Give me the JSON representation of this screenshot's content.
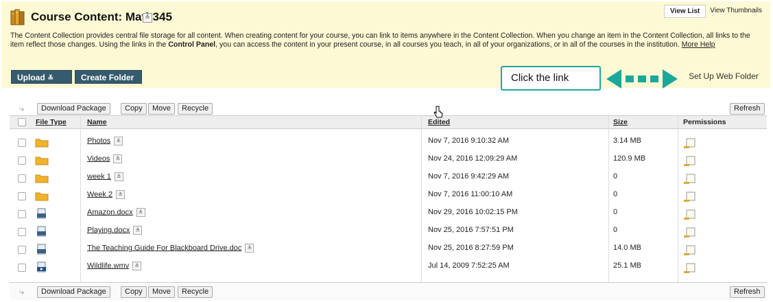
{
  "header": {
    "title": "Course Content: Math345",
    "view_list": "View List",
    "view_thumbnails": "View Thumbnails",
    "description_part1": "The Content Collection provides central file storage for all content. When creating content for your course, you can link to items anywhere in the Content Collection. When you change an item in the Content Collection, all links to the item reflect those changes. Using the links in the ",
    "description_bold": "Control Panel",
    "description_part2": ", you can access the content in your present course, in all courses you teach, in all of your organizations, or in all of the courses in the institution. ",
    "more_help": "More Help"
  },
  "toolbar": {
    "upload_label": "Upload",
    "create_folder_label": "Create Folder",
    "set_up_web_folder": "Set Up Web Folder"
  },
  "callout": {
    "text": "Click the link",
    "color": "#1aa89a"
  },
  "actions": {
    "download_package": "Download Package",
    "copy": "Copy",
    "move": "Move",
    "recycle": "Recycle",
    "refresh": "Refresh"
  },
  "columns": {
    "file_type": "File Type",
    "name": "Name",
    "edited": "Edited",
    "size": "Size",
    "permissions": "Permissions"
  },
  "rows": [
    {
      "type": "folder",
      "name": "Photos",
      "edited": "Nov 7, 2016 9:10:32 AM",
      "size": "3.14 MB"
    },
    {
      "type": "folder",
      "name": "Videos",
      "edited": "Nov 24, 2016 12:09:29 AM",
      "size": "120.9 MB"
    },
    {
      "type": "folder",
      "name": "week 1",
      "edited": "Nov 7, 2016 9:42:29 AM",
      "size": "0"
    },
    {
      "type": "folder",
      "name": "Week 2",
      "edited": "Nov 7, 2016 11:00:10 AM",
      "size": "0"
    },
    {
      "type": "document",
      "name": "Amazon.docx",
      "edited": "Nov 29, 2016 10:02:15 PM",
      "size": "0"
    },
    {
      "type": "document",
      "name": "Playing.docx",
      "edited": "Nov 25, 2016 7:57:51 PM",
      "size": "0"
    },
    {
      "type": "document",
      "name": "The Teaching Guide For Blackboard Drive.doc",
      "edited": "Nov 25, 2016 8:27:59 PM",
      "size": "14.0 MB"
    },
    {
      "type": "video",
      "name": "Wildlife.wmv",
      "edited": "Jul 14, 2009 7:52:25 AM",
      "size": "25.1 MB"
    }
  ],
  "colors": {
    "header_bg": "#fdf9d4",
    "button_dark": "#365b6e",
    "folder": "#f0b429"
  }
}
